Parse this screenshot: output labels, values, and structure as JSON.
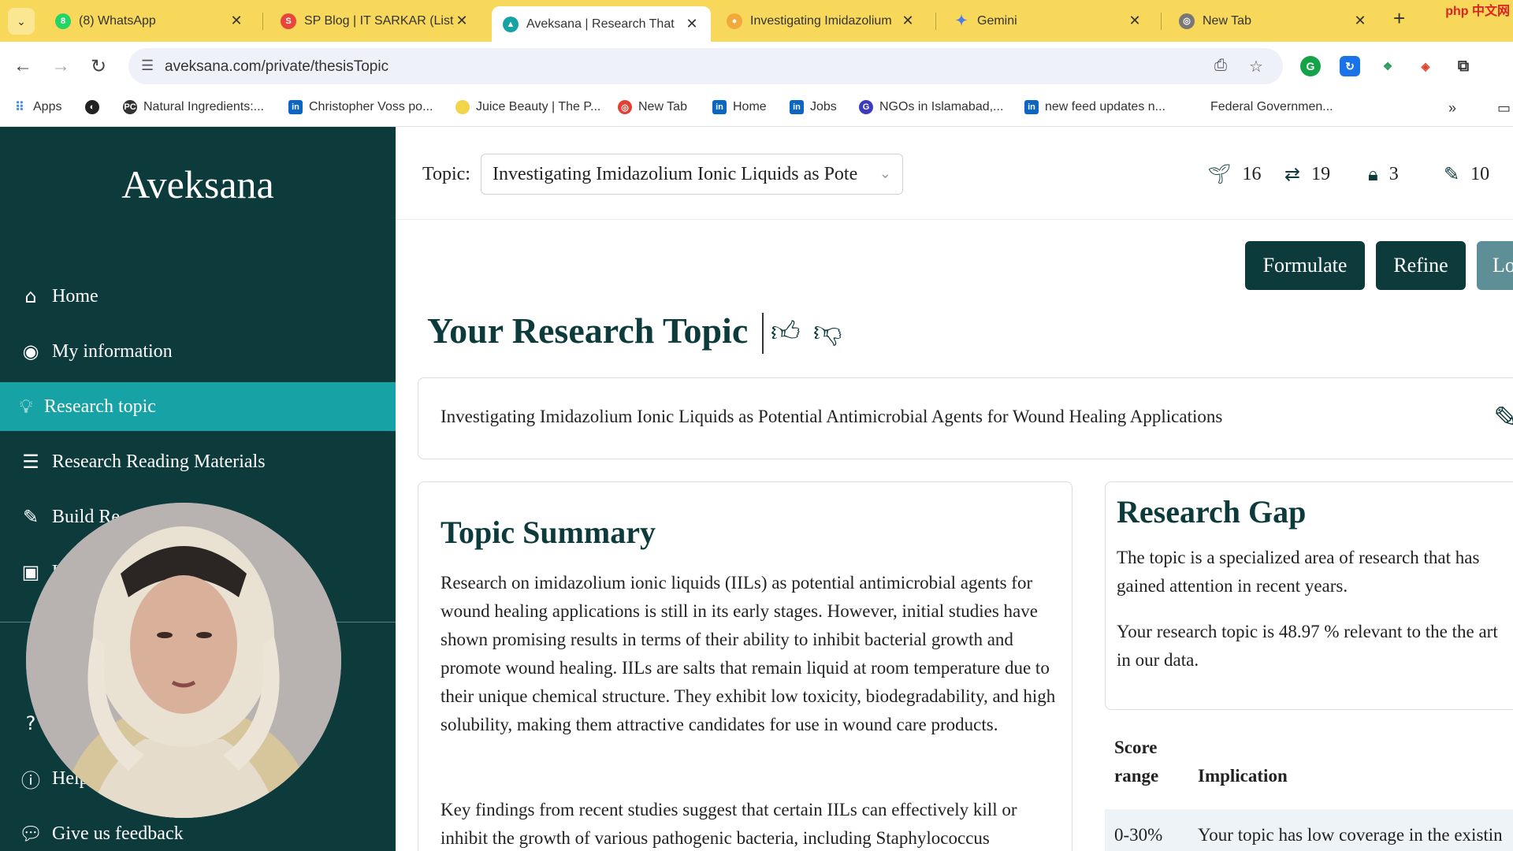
{
  "browser": {
    "tabs": [
      {
        "title": "(8) WhatsApp",
        "icon": "whatsapp-icon",
        "color": "#25d366"
      },
      {
        "title": "SP Blog | IT SARKAR (List)",
        "icon": "sp-blog-icon",
        "color": "#e8453c"
      },
      {
        "title": "Aveksana | Research That",
        "icon": "aveksana-icon",
        "color": "#17a2a6"
      },
      {
        "title": "Investigating Imidazolium",
        "icon": "investigating-icon",
        "color": "#f2a93b"
      },
      {
        "title": "Gemini",
        "icon": "gemini-icon",
        "color": "#4b7bec"
      },
      {
        "title": "New Tab",
        "icon": "chrome-icon",
        "color": "#777777"
      }
    ],
    "url": "aveksana.com/private/thesisTopic",
    "bookmarks": [
      {
        "label": "Apps"
      },
      {
        "label": ""
      },
      {
        "label": "Natural Ingredients:..."
      },
      {
        "label": "Christopher Voss po..."
      },
      {
        "label": "Juice Beauty | The P..."
      },
      {
        "label": "New Tab"
      },
      {
        "label": "Home"
      },
      {
        "label": "Jobs"
      },
      {
        "label": "NGOs in Islamabad,..."
      },
      {
        "label": "new feed updates n..."
      },
      {
        "label": "Federal Governmen..."
      }
    ],
    "watermark": "php 中文网"
  },
  "sidebar": {
    "brand": "Aveksana",
    "items": [
      {
        "label": "Home",
        "icon": "home-icon"
      },
      {
        "label": "My information",
        "icon": "user-circle-icon"
      },
      {
        "label": "Research topic",
        "icon": "lightbulb-icon"
      },
      {
        "label": "Research Reading Materials",
        "icon": "list-icon"
      },
      {
        "label": "Build Re",
        "icon": "edit-icon"
      },
      {
        "label": "U",
        "icon": "calendar-plus-icon"
      },
      {
        "label": "",
        "icon": "question-icon"
      },
      {
        "label": "Help",
        "icon": "info-icon"
      },
      {
        "label": "Give us feedback",
        "icon": "comments-icon"
      }
    ]
  },
  "topbar": {
    "topic_label": "Topic:",
    "topic_value": "Investigating Imidazolium Ionic Liquids as Pote",
    "stats": [
      {
        "icon": "seedling-icon",
        "value": "16"
      },
      {
        "icon": "retweet-icon",
        "value": "19"
      },
      {
        "icon": "lock-icon",
        "value": "3"
      },
      {
        "icon": "edit-icon",
        "value": "10"
      }
    ]
  },
  "actions": {
    "formulate": "Formulate",
    "refine": "Refine",
    "third": "Lo"
  },
  "research_topic": {
    "heading": "Your Research Topic",
    "text": "Investigating Imidazolium Ionic Liquids as Potential Antimicrobial Agents for Wound Healing Applications"
  },
  "summary": {
    "heading": "Topic Summary",
    "p1": "Research on imidazolium ionic liquids (IILs) as potential antimicrobial agents for wound healing applications is still in its early stages. However, initial studies have shown promising results in terms of their ability to inhibit bacterial growth and promote wound healing. IILs are salts that remain liquid at room temperature due to their unique chemical structure. They exhibit low toxicity, biodegradability, and high solubility, making them attractive candidates for use in wound care products.",
    "p2": "Key findings from recent studies suggest that certain IILs can effectively kill or inhibit the growth of various pathogenic bacteria, including Staphylococcus"
  },
  "gap": {
    "heading": "Research Gap",
    "p1": "The topic is a specialized area of research that has gained attention in recent years.",
    "p2": "Your research topic is 48.97 % relevant to the the art",
    "p3": "in our data."
  },
  "score_table": {
    "col1_line1": "Score",
    "col1_line2": "range",
    "col2": "Implication",
    "row1_range": "0-30%",
    "row1_text": "Your topic has low coverage in the existin"
  },
  "colors": {
    "sidebar": "#0d3b3c",
    "accent": "#17a2a6",
    "tabbar": "#f7d85a"
  }
}
